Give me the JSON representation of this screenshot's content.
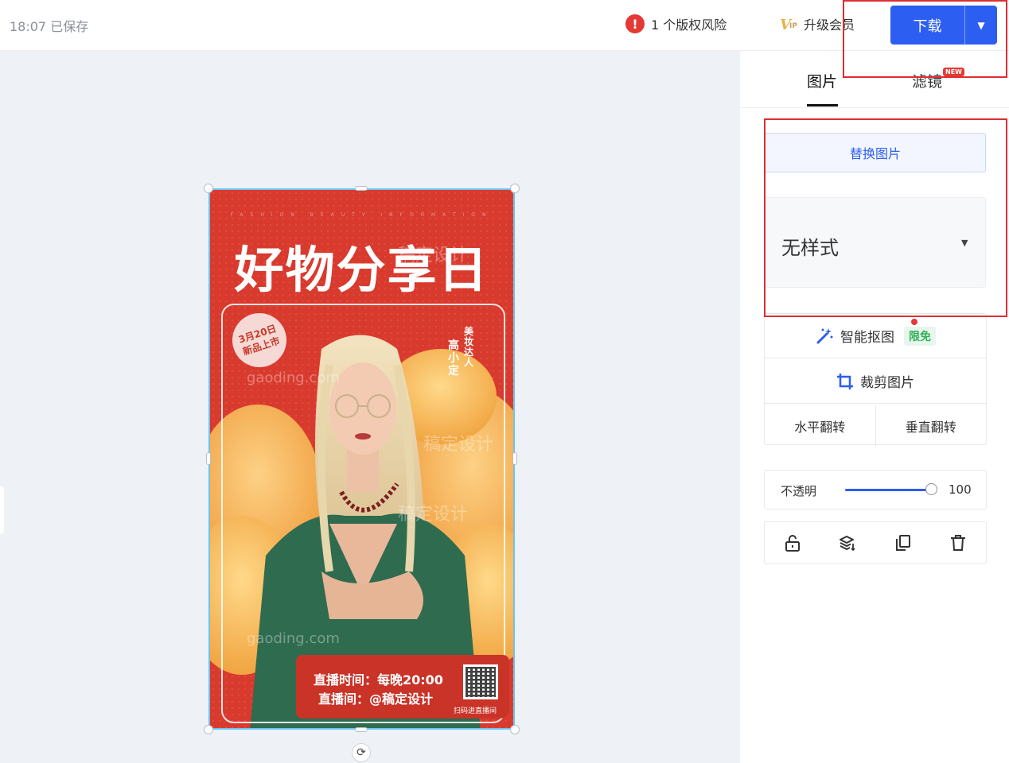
{
  "topbar": {
    "saved_status": "18:07 已保存",
    "copyright_warning": "1 个版权风险",
    "upgrade_label": "升级会员",
    "vip_icon_letter": "V",
    "vip_icon_sub": "IP",
    "download_label": "下载"
  },
  "poster": {
    "tagline": "FASHION BEAUTY INFORMATION",
    "headline": "好物分享日",
    "date_line1": "3月20日",
    "date_line2": "新品上市",
    "vertical_1": "美妆达人",
    "vertical_2": "高小定",
    "watermark_site_1": "gaoding.com",
    "watermark_site_2": "gaoding.com",
    "watermark_brand_1": "稿定设计",
    "watermark_brand_2": "稿定设计",
    "watermark_brand_3": "稿定设计",
    "live_time": "直播时间：每晚20:00",
    "live_room": "直播间：@稿定设计",
    "qr_caption": "扫码进直播间"
  },
  "panel": {
    "tabs": [
      {
        "label": "图片"
      },
      {
        "label": "滤镜"
      }
    ],
    "new_badge": "NEW",
    "replace_button": "替换图片",
    "style_select_value": "无样式",
    "smart_cutout": "智能抠图",
    "free_badge": "限免",
    "crop": "裁剪图片",
    "flip_h": "水平翻转",
    "flip_v": "垂直翻转",
    "opacity_label": "不透明",
    "opacity_value": "100"
  },
  "colors": {
    "accent": "#2c5ef2",
    "poster_red": "#d93a2e",
    "highlight": "#e02c33"
  },
  "icons": [
    "warning-icon",
    "vip-icon",
    "caret-down-icon",
    "magic-wand-icon",
    "crop-icon",
    "unlock-icon",
    "layers-icon",
    "copy-icon",
    "trash-icon",
    "rotate-icon"
  ]
}
